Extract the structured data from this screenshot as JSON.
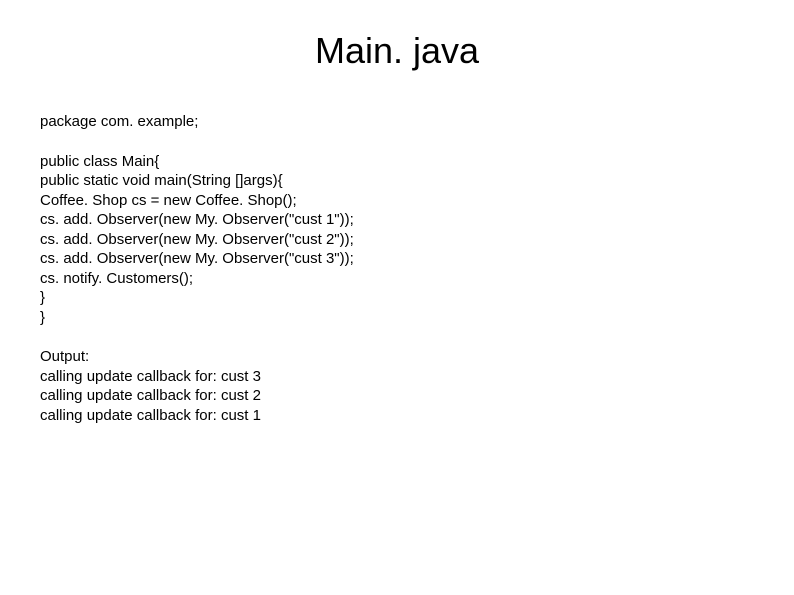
{
  "title": "Main. java",
  "package_line": "package com. example;",
  "code_lines": [
    "public class Main{",
    "public static void main(String []args){",
    "Coffee. Shop cs = new Coffee. Shop();",
    "cs. add. Observer(new My. Observer(\"cust 1\"));",
    "cs. add. Observer(new My. Observer(\"cust 2\"));",
    "cs. add. Observer(new My. Observer(\"cust 3\"));",
    "cs. notify. Customers();",
    "}",
    "}"
  ],
  "output_header": "Output:",
  "output_lines": [
    "calling update callback for: cust 3",
    "calling update callback for: cust 2",
    "calling update callback for: cust 1"
  ]
}
